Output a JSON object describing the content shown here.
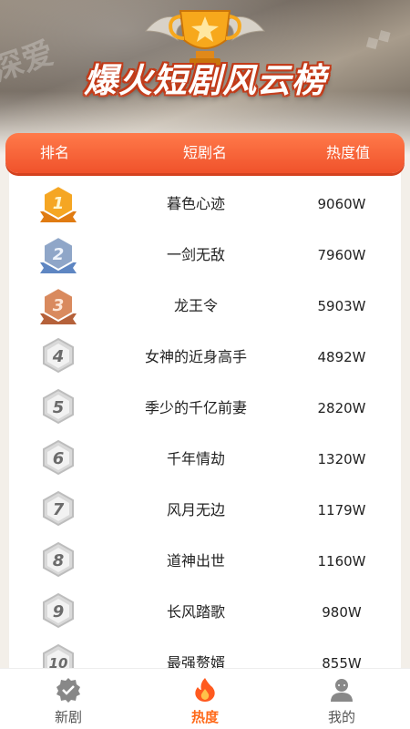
{
  "header": {
    "title": "爆火短剧风云榜",
    "columns": {
      "rank": "排名",
      "name": "短剧名",
      "heat": "热度值"
    }
  },
  "rankings": [
    {
      "rank": "1",
      "name": "暮色心迹",
      "heat": "9060W",
      "tier": "gold"
    },
    {
      "rank": "2",
      "name": "一剑无敌",
      "heat": "7960W",
      "tier": "silver"
    },
    {
      "rank": "3",
      "name": "龙王令",
      "heat": "5903W",
      "tier": "bronze"
    },
    {
      "rank": "4",
      "name": "女神的近身高手",
      "heat": "4892W",
      "tier": "plain"
    },
    {
      "rank": "5",
      "name": "季少的千亿前妻",
      "heat": "2820W",
      "tier": "plain"
    },
    {
      "rank": "6",
      "name": "千年情劫",
      "heat": "1320W",
      "tier": "plain"
    },
    {
      "rank": "7",
      "name": "风月无边",
      "heat": "1179W",
      "tier": "plain"
    },
    {
      "rank": "8",
      "name": "道神出世",
      "heat": "1160W",
      "tier": "plain"
    },
    {
      "rank": "9",
      "name": "长风踏歌",
      "heat": "980W",
      "tier": "plain"
    },
    {
      "rank": "10",
      "name": "最强赘婿",
      "heat": "855W",
      "tier": "plain"
    }
  ],
  "nav": [
    {
      "label": "新剧",
      "icon": "badge-check-icon",
      "active": false
    },
    {
      "label": "热度",
      "icon": "flame-icon",
      "active": true
    },
    {
      "label": "我的",
      "icon": "user-icon",
      "active": false
    }
  ],
  "colors": {
    "accent": "#f0522b",
    "active_nav": "#ff6a1a",
    "gold": "#f5a623",
    "silver": "#8fa6c8",
    "bronze": "#d98a5e",
    "plain_badge": "#8a8a8a"
  }
}
